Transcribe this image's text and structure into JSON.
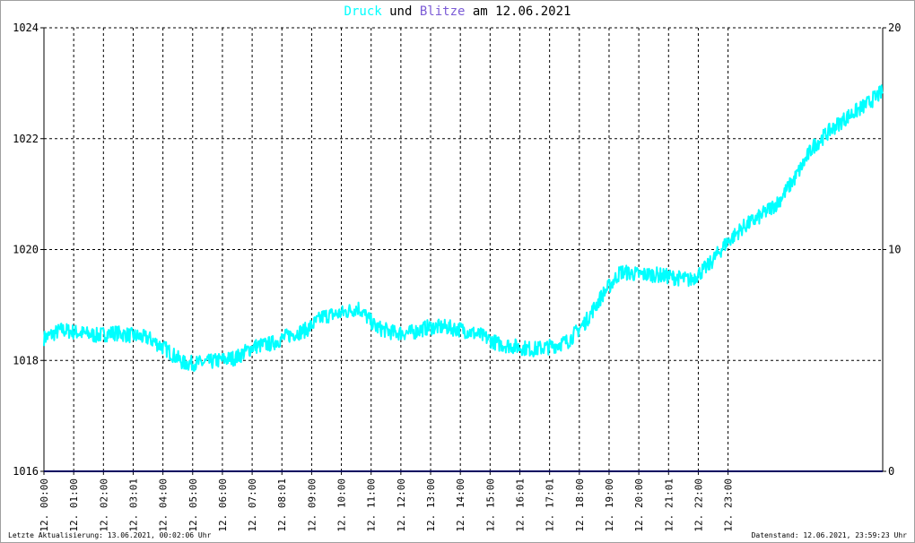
{
  "title": {
    "series1": "Druck",
    "conj": "und",
    "series2": "Blitze",
    "date_prefix": "am",
    "date": "12.06.2021"
  },
  "footer": {
    "left": "Letzte Aktualisierung: 13.06.2021, 00:02:06 Uhr",
    "right": "Datenstand: 12.06.2021, 23:59:23 Uhr"
  },
  "colors": {
    "pressure": "#00ffff",
    "lightning": "#7b5bd6",
    "lightning_line": "#000060",
    "grid": "#000000"
  },
  "chart_data": {
    "type": "line",
    "title": "Druck und Blitze am 12.06.2021",
    "grid": true,
    "y_left": {
      "min": 1016,
      "max": 1024,
      "ticks": [
        "1016",
        "1018",
        "1020",
        "1022",
        "1024"
      ]
    },
    "y_right": {
      "min": 0,
      "max": 20,
      "ticks": [
        "0",
        "10",
        "20"
      ]
    },
    "x_ticks": [
      "12. 00:00",
      "12. 01:00",
      "12. 02:00",
      "12. 03:01",
      "12. 04:00",
      "12. 05:00",
      "12. 06:00",
      "12. 07:00",
      "12. 08:01",
      "12. 09:00",
      "12. 10:00",
      "12. 11:00",
      "12. 12:00",
      "12. 13:00",
      "12. 14:00",
      "12. 15:00",
      "12. 16:01",
      "12. 17:01",
      "12. 18:00",
      "12. 19:00",
      "12. 20:00",
      "12. 21:01",
      "12. 22:00",
      "12. 23:00"
    ],
    "series": [
      {
        "name": "Druck",
        "axis": "left",
        "x_hours": [
          0,
          0.5,
          1,
          1.5,
          2,
          2.5,
          3,
          3.5,
          4,
          4.5,
          5,
          5.5,
          6,
          6.5,
          7,
          7.5,
          8,
          8.5,
          9,
          9.5,
          10,
          10.5,
          11,
          11.5,
          12,
          12.5,
          13,
          13.5,
          14,
          14.5,
          15,
          15.5,
          16,
          16.5,
          17,
          17.5,
          18,
          18.5,
          19,
          19.5,
          20,
          20.5,
          21,
          21.5,
          22,
          22.5,
          23,
          23.5,
          24
        ],
        "values": [
          1018.4,
          1018.55,
          1018.5,
          1018.45,
          1018.5,
          1018.45,
          1018.4,
          1018.2,
          1017.95,
          1017.95,
          1018.0,
          1018.05,
          1018.25,
          1018.3,
          1018.45,
          1018.55,
          1018.8,
          1018.85,
          1018.95,
          1018.6,
          1018.5,
          1018.5,
          1018.6,
          1018.6,
          1018.55,
          1018.45,
          1018.3,
          1018.25,
          1018.2,
          1018.25,
          1018.35,
          1018.7,
          1019.2,
          1019.6,
          1019.55,
          1019.55,
          1019.5,
          1019.45,
          1019.7,
          1020.1,
          1020.4,
          1020.6,
          1020.85,
          1021.3,
          1021.85,
          1022.15,
          1022.4,
          1022.6,
          1022.85
        ]
      },
      {
        "name": "Blitze",
        "axis": "right",
        "x_hours": [
          0,
          24
        ],
        "values": [
          0,
          0
        ]
      }
    ]
  }
}
